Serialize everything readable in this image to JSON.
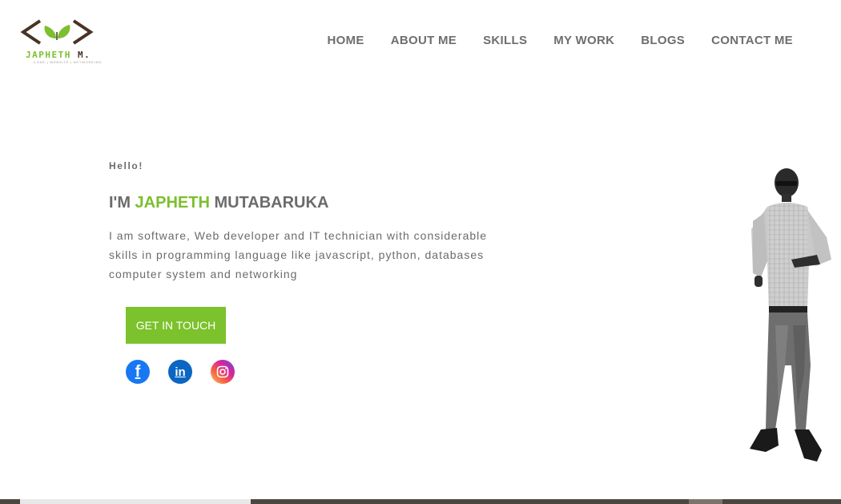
{
  "logo": {
    "first_name": "JAPHETH",
    "last_name": "M.",
    "tagline": "CODE | WEBSITE | NETWORKING",
    "icon": "code-brackets-leaves-icon"
  },
  "nav": {
    "items": [
      {
        "label": "HOME"
      },
      {
        "label": "ABOUT ME"
      },
      {
        "label": "SKILLS"
      },
      {
        "label": "MY WORK"
      },
      {
        "label": "BLOGS"
      },
      {
        "label": "CONTACT ME"
      }
    ]
  },
  "hero": {
    "greeting": "Hello!",
    "title_prefix": "I'M ",
    "title_highlight": "JAPHETH",
    "title_suffix": " MUTABARUKA",
    "description": "I am software, Web developer and IT technician with considerable skills in programming language like javascript, python, databases computer system and networking",
    "cta_label": "GET IN TOUCH"
  },
  "social": [
    {
      "name": "facebook",
      "icon": "facebook-icon",
      "glyph": "f"
    },
    {
      "name": "linkedin",
      "icon": "linkedin-icon",
      "glyph": "in"
    },
    {
      "name": "instagram",
      "icon": "instagram-icon"
    }
  ],
  "colors": {
    "accent": "#7cc22c",
    "text": "#6b6b6b",
    "logo_brown": "#4a3324",
    "facebook": "#1877f2",
    "linkedin": "#0a66c2"
  }
}
